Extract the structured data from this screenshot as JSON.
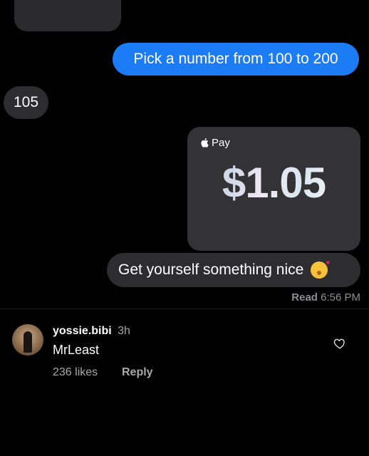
{
  "messages": {
    "outgoing_question": "Pick a number from 100 to 200",
    "incoming_reply": "105",
    "apple_pay": {
      "label": "Pay",
      "amount": "$1.05"
    },
    "outgoing_note": "Get yourself something nice",
    "note_emoji": "kissing-face-emoji",
    "read_status": "Read",
    "read_time": "6:56 PM"
  },
  "comment": {
    "username": "yossie.bibi",
    "time_ago": "3h",
    "text": "MrLeast",
    "likes": "236 likes",
    "reply_label": "Reply",
    "icons": {
      "like": "heart-outline-icon",
      "avatar": "profile-avatar"
    }
  },
  "colors": {
    "background": "#000000",
    "outgoing_bubble": "#1c7cf5",
    "incoming_bubble": "#2d2d2f",
    "pay_card": "#333335",
    "secondary_text": "#a8a8a8"
  }
}
